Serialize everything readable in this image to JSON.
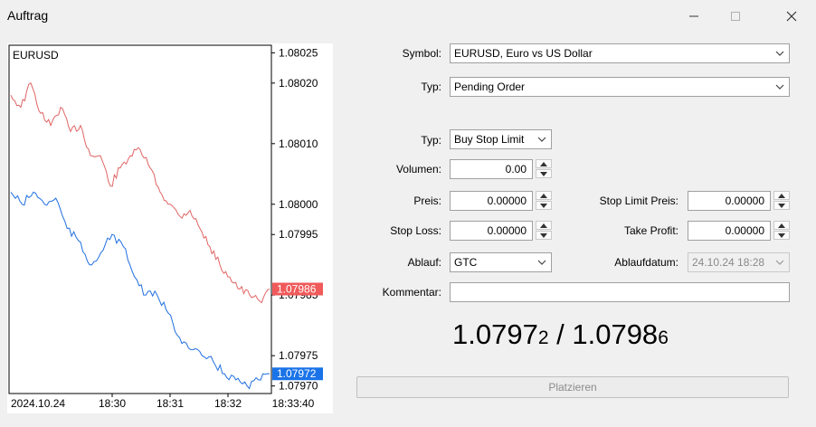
{
  "window": {
    "title": "Auftrag"
  },
  "chart": {
    "symbol": "EURUSD",
    "price_ticks": [
      "1.08025",
      "1.08020",
      "1.08010",
      "1.08000",
      "1.07995",
      "1.07985",
      "1.07975",
      "1.07970"
    ],
    "time_ticks": [
      "2024.10.24",
      "18:30",
      "18:31",
      "18:32",
      "18:33:40"
    ],
    "ask_label": "1.07986",
    "bid_label": "1.07972",
    "colors": {
      "ask": "#e06464",
      "bid": "#1f6fe0",
      "ask_tag": "#f05a5a",
      "bid_tag": "#1a73e8"
    }
  },
  "chart_data": {
    "type": "line",
    "x_range": [
      "2024.10.24 18:29:30",
      "18:33:40"
    ],
    "ylim": [
      1.0796875,
      1.0802625
    ],
    "series": [
      {
        "values": [
          1.08018,
          1.08016,
          1.0802,
          1.08015,
          1.08013,
          1.08016,
          1.08012,
          1.08013,
          1.08008,
          1.08008,
          1.08003,
          1.08006,
          1.08008,
          1.08009,
          1.08006,
          1.08002,
          1.08,
          1.07998,
          1.07999,
          1.07996,
          1.07993,
          1.0799,
          1.07988,
          1.07986,
          1.07985,
          1.07984,
          1.07986
        ]
      },
      {
        "values": [
          1.08002,
          1.08,
          1.08002,
          1.08,
          1.08001,
          1.07996,
          1.07994,
          1.0799,
          1.07992,
          1.07995,
          1.07993,
          1.07988,
          1.07985,
          1.07985,
          1.07982,
          1.07978,
          1.07976,
          1.07975,
          1.07974,
          1.07972,
          1.07971,
          1.0797,
          1.07971,
          1.07972
        ]
      }
    ]
  },
  "form": {
    "symbol_label": "Symbol:",
    "symbol_value": "EURUSD, Euro vs US Dollar",
    "typ_label": "Typ:",
    "typ_value": "Pending Order",
    "order_type_label": "Typ:",
    "order_type_value": "Buy Stop Limit",
    "volumen_label": "Volumen:",
    "volumen_value": "0.00",
    "preis_label": "Preis:",
    "preis_value": "0.00000",
    "stop_limit_label": "Stop Limit Preis:",
    "stop_limit_value": "0.00000",
    "stop_loss_label": "Stop Loss:",
    "stop_loss_value": "0.00000",
    "take_profit_label": "Take Profit:",
    "take_profit_value": "0.00000",
    "ablauf_label": "Ablauf:",
    "ablauf_value": "GTC",
    "ablaufdatum_label": "Ablaufdatum:",
    "ablaufdatum_value": "24.10.24 18:28",
    "kommentar_label": "Kommentar:",
    "kommentar_value": ""
  },
  "quote": {
    "bid_main": "1.0797",
    "bid_small": "2",
    "sep": " / ",
    "ask_main": "1.0798",
    "ask_small": "6"
  },
  "buttons": {
    "place": "Platzieren"
  }
}
